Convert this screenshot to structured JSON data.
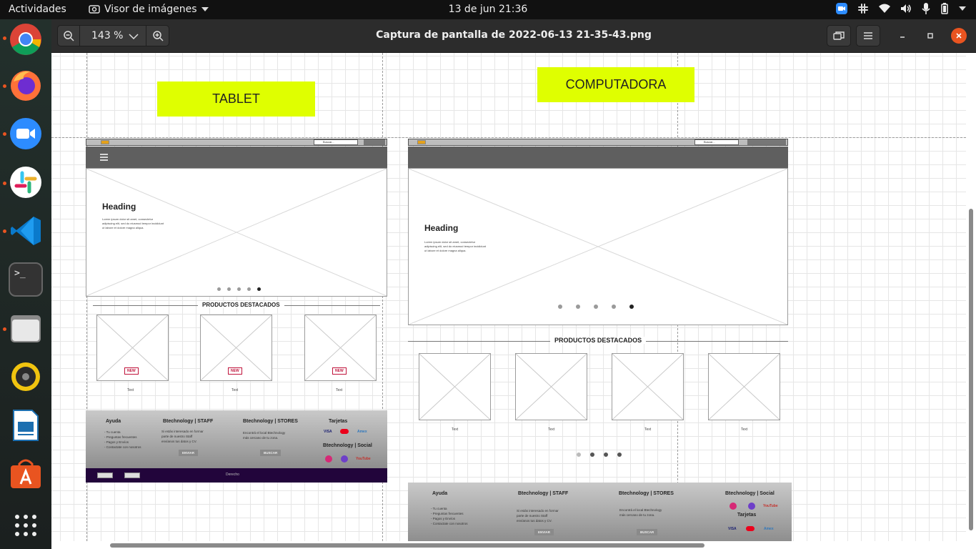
{
  "topbar": {
    "activities": "Actividades",
    "app_name": "Visor de imágenes",
    "clock": "13 de jun  21:36"
  },
  "dock": {
    "items": [
      {
        "name": "chrome",
        "running": true
      },
      {
        "name": "firefox",
        "running": true
      },
      {
        "name": "zoom",
        "running": true
      },
      {
        "name": "slack",
        "running": true
      },
      {
        "name": "vscode",
        "running": true
      },
      {
        "name": "terminal",
        "running": false
      },
      {
        "name": "files",
        "running": true
      },
      {
        "name": "rhythmbox",
        "running": false
      },
      {
        "name": "libreoffice-impress",
        "running": false
      },
      {
        "name": "app-center",
        "running": false
      },
      {
        "name": "show-apps",
        "running": false
      }
    ],
    "terminal_glyph": ">_"
  },
  "viewer": {
    "zoom": "143 %",
    "title": "Captura de pantalla de 2022-06-13 21-35-43.png"
  },
  "image": {
    "tablet_label": "TABLET",
    "computer_label": "COMPUTADORA",
    "search_placeholder": "Buscar...",
    "heading": "Heading",
    "lorem": "Lorem ipsum dolor sit amet, consectetur adipiscing elit, sed do eiusmod tempor incididunt ut labore et dolore magna aliqua.",
    "featured_title": "PRODUCTOS DESTACADOS",
    "badge": "NEW",
    "product_text": "Text",
    "footer": {
      "col1_title": "Ayuda",
      "col1_items": "- Tu cuenta\n- Preguntas frecuentes\n- Pagos y Envíos\n- Contactate con nosotros",
      "col2_title": "Btechnology | STAFF",
      "col2_text": "Si estás interesado en formar\nparte de nuestro Staff\nenvíanos tus datos y CV.",
      "col2_btn": "ENVIAR",
      "col3_title": "Btechnology | STORES",
      "col3_text": "Encontrá el local Btechnology\nmás cercano de tu zona.",
      "col3_btn": "BUSCAR",
      "col4_title": "Tarjetas",
      "social_title": "Btechnology | Social",
      "cards": [
        "VISA",
        "MC",
        "Amex"
      ],
      "youtube": "YouTube",
      "sub_text": "Derecho"
    }
  },
  "colors": {
    "label_bg": "#dfff00",
    "nav_gray": "#5f5f5f",
    "subfooter": "#22053b",
    "badge": "#c0143c",
    "close_button": "#e95420"
  }
}
